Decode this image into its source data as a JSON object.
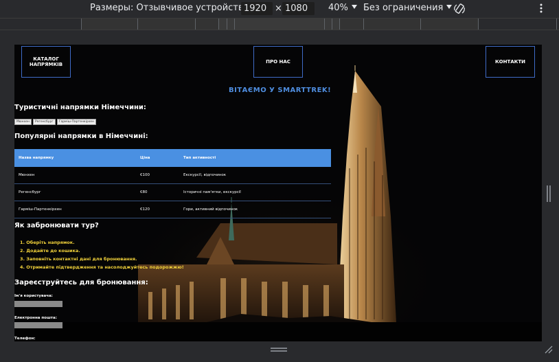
{
  "devtools": {
    "device_label": "Размеры: Отзывчивое устройство",
    "width": "1920",
    "times": "×",
    "height": "1080",
    "zoom": "40%",
    "throttle": "Без ограничения"
  },
  "nav": {
    "catalog": "КАТАЛОГ НАПРЯМКІВ",
    "about": "ПРО НАС",
    "contacts": "КОНТАКТИ"
  },
  "welcome": "ВІТАЄМО У SMARTTREK!",
  "tourist": {
    "heading": "Туристичні напрямки Німеччини:",
    "tags": [
      "Мюнхен",
      "Регенсбург",
      "Гарміш-Партенкірхен"
    ]
  },
  "popular": {
    "heading": "Популярні напрямки в Німеччині:",
    "columns": [
      "Назва напрямку",
      "Ціна",
      "Тип активності"
    ],
    "rows": [
      [
        "Мюнхен",
        "€100",
        "Екскурсії, відпочинок"
      ],
      [
        "Регенсбург",
        "€80",
        "Історичні пам'ятки, екскурсії"
      ],
      [
        "Гарміш-Партенкірхен",
        "€120",
        "Гори, активний відпочинок"
      ]
    ]
  },
  "booking": {
    "heading": "Як забронювати тур?",
    "steps": [
      "1. Оберіть напрямок.",
      "2. Додайте до кошика.",
      "3. Заповніть контактні дані для бронювання.",
      "4. Отримайте підтвердження та насолоджуйтесь подорожжю!"
    ]
  },
  "register": {
    "heading": "Зареєструйтесь для бронювання:",
    "username_label": "Ім'я користувача:",
    "email_label": "Електронна пошта:",
    "phone_label": "Телефон:"
  }
}
